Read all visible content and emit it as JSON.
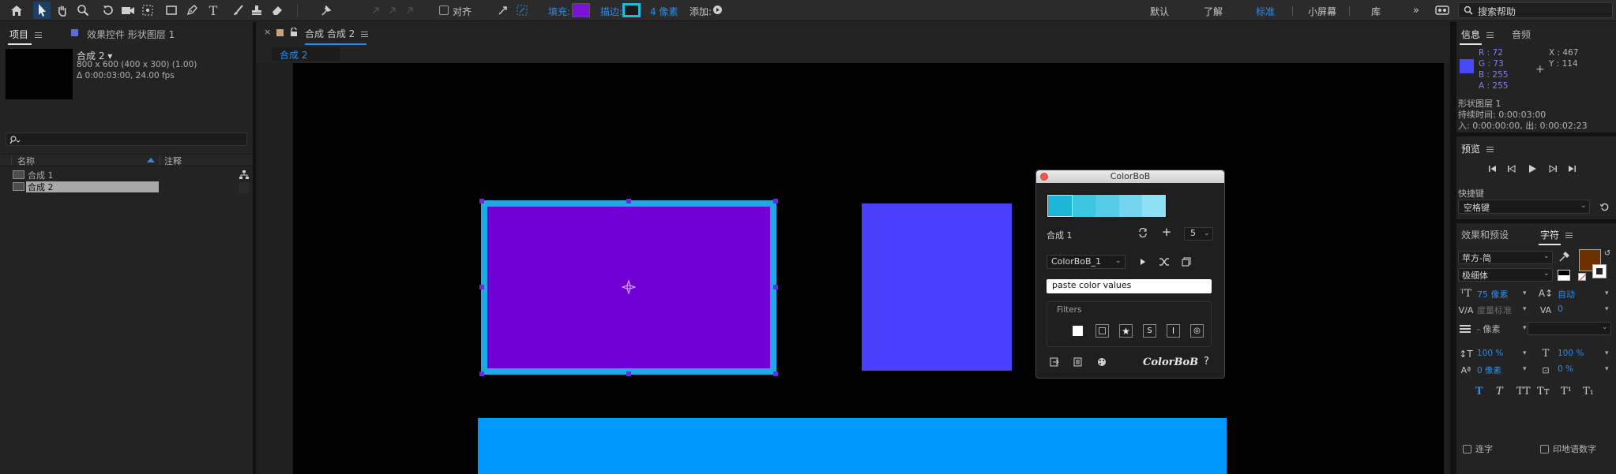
{
  "toolbar": {
    "align_label": "对齐",
    "fill_label": "填充:",
    "fill_color": "#7a13d6",
    "stroke_label": "描边:",
    "stroke_width": "4 像素",
    "add_label": "添加:",
    "workspaces": [
      "默认",
      "了解",
      "标准",
      "小屏幕",
      "库"
    ],
    "active_workspace": "标准",
    "search_placeholder": "搜索帮助"
  },
  "project_panel": {
    "tab_project": "项目",
    "tab_effects": "效果控件 形状图层 1",
    "comp_name": "合成 2 ▾",
    "comp_size": "800 x 600  (400 x 300) (1.00)",
    "comp_duration": "Δ 0:00:03:00, 24.00 fps",
    "search_placeholder": "",
    "col_name": "名称",
    "col_comment": "注释",
    "items": [
      {
        "name": "合成 1",
        "selected": false
      },
      {
        "name": "合成 2",
        "selected": true
      }
    ]
  },
  "comp_panel": {
    "tab_title": "合成 合成 2",
    "breadcrumb": "合成 2"
  },
  "canvas_shapes": {
    "purple_fill": "#7000d4",
    "stroke_color": "#1fa9e6",
    "blue_fill": "#4a3ffc",
    "cyan_fill": "#0099ff"
  },
  "colorbob": {
    "title": "ColorBoB",
    "swatches": [
      "#1db6d6",
      "#3dc4e0",
      "#57cce8",
      "#74d5ee",
      "#8ee0f4"
    ],
    "comp_label": "合成 1",
    "count_value": "5",
    "palette_name": "ColorBoB_1",
    "paste_label": "paste color values",
    "filters_label": "Filters",
    "logo": "ColorBoB",
    "help": "?"
  },
  "info_panel": {
    "tab_info": "信息",
    "tab_audio": "音频",
    "swatch_color": "#4849ff",
    "r": "R : 72",
    "g": "G : 73",
    "b": "B : 255",
    "a": "A : 255",
    "x": "X : 467",
    "y": "Y : 114",
    "layer_name": "形状图层 1",
    "duration": "持续时间: 0:00:03:00",
    "in_out": "入: 0:00:00:00,  出: 0:00:02:23"
  },
  "preview_panel": {
    "title": "预览",
    "shortcut_label": "快捷键",
    "shortcut_value": "空格键"
  },
  "char_panel": {
    "tab_effects": "效果和预设",
    "tab_char": "字符",
    "font_name": "苹方-简",
    "font_style": "极细体",
    "font_size": "75 像素",
    "leading": "自动",
    "kerning": "度量标准",
    "tracking": "0",
    "stroke_width": "- 像素",
    "vscale": "100 %",
    "hscale": "100 %",
    "baseline": "0 像素",
    "tsume": "0 %",
    "text_color": "#6b3000",
    "ligature": "连字",
    "indic": "印地语数字"
  }
}
